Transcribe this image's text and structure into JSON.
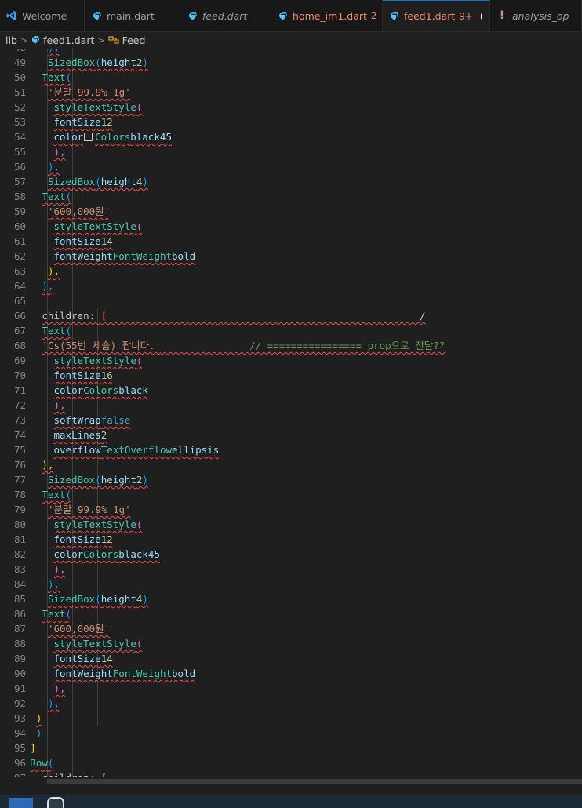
{
  "tabs": [
    {
      "label": "Welcome",
      "icon": "vscode-logo-icon",
      "style": "normal",
      "state": "plain"
    },
    {
      "label": "main.dart",
      "icon": "dart-icon",
      "style": "normal",
      "state": "plain"
    },
    {
      "label": "feed.dart",
      "icon": "dart-icon",
      "style": "italic",
      "state": "plain"
    },
    {
      "label": "home_im1.dart",
      "icon": "dart-icon",
      "style": "normal",
      "state": "error",
      "badge": "2",
      "dot": true
    },
    {
      "label": "feed1.dart",
      "icon": "dart-icon",
      "style": "normal",
      "state": "active",
      "badge": "9+",
      "dot": true
    },
    {
      "label": "analysis_op",
      "icon": "exclamation-icon",
      "style": "italic",
      "state": "plain"
    }
  ],
  "breadcrumb": {
    "folder": "lib",
    "file": "feed1.dart",
    "symbol": "Feed"
  },
  "editor": {
    "first_line": 48,
    "lines": [
      [
        [
          "b3",
          "),",
          1
        ]
      ],
      [
        [
          "k",
          "SizedBox",
          1
        ],
        [
          "b3",
          "(",
          1
        ],
        [
          "p",
          "height",
          1
        ],
        [
          "",
          "",
          1
        ],
        [
          "n",
          "2",
          1
        ],
        [
          "b3",
          ")",
          1
        ],
        [
          "",
          "",
          1
        ]
      ],
      [
        [
          "k",
          "Text",
          1
        ],
        [
          "b3",
          "(",
          1
        ]
      ],
      [
        [
          "s",
          "'분말 99.9% 1g'",
          1
        ],
        [
          "",
          "",
          1
        ]
      ],
      [
        [
          "k",
          "style",
          1
        ],
        [
          "",
          "",
          1
        ],
        [
          "k",
          "TextStyle",
          1
        ],
        [
          "b2",
          "(",
          1
        ]
      ],
      [
        [
          "p",
          "fontSize",
          1
        ],
        [
          "",
          "",
          1
        ],
        [
          "n",
          "12",
          1
        ],
        [
          "",
          "",
          1
        ]
      ],
      [
        [
          "p",
          "color",
          1
        ],
        [
          "",
          "",
          1
        ],
        [
          "sw",
          "",
          0
        ],
        [
          "k",
          "Colors",
          1
        ],
        [
          "",
          "",
          1
        ],
        [
          "p",
          "black45",
          1
        ],
        [
          "",
          "",
          1
        ]
      ],
      [
        [
          "b2",
          "),",
          1
        ]
      ],
      [
        [
          "b3",
          "),",
          1
        ]
      ],
      [
        [
          "k",
          "SizedBox",
          1
        ],
        [
          "b3",
          "(",
          1
        ],
        [
          "p",
          "height",
          1
        ],
        [
          "",
          "",
          1
        ],
        [
          "n",
          "4",
          1
        ],
        [
          "b3",
          ")",
          1
        ],
        [
          "",
          "",
          1
        ]
      ],
      [
        [
          "k",
          "Text",
          1
        ],
        [
          "b3",
          "(",
          1
        ]
      ],
      [
        [
          "s",
          "'600,000원'",
          1
        ],
        [
          "",
          "",
          1
        ]
      ],
      [
        [
          "k",
          "style",
          1
        ],
        [
          "",
          "",
          1
        ],
        [
          "k",
          "TextStyle",
          1
        ],
        [
          "b2",
          "(",
          1
        ]
      ],
      [
        [
          "p",
          "fontSize",
          1
        ],
        [
          "",
          "",
          1
        ],
        [
          "n",
          "14",
          1
        ],
        [
          "",
          "",
          1
        ]
      ],
      [
        [
          "p",
          "fontWeight",
          1
        ],
        [
          "",
          "",
          1
        ],
        [
          "k",
          "FontWeight",
          1
        ],
        [
          "",
          "",
          1
        ],
        [
          "p",
          "bold",
          1
        ],
        [
          "",
          "",
          1
        ]
      ],
      [
        [
          "b1",
          "),",
          1
        ]
      ],
      [
        [
          "b3",
          "),",
          1
        ]
      ],
      [],
      [
        [
          "",
          "children: ",
          1
        ],
        [
          "bred",
          "[",
          1
        ],
        [
          "",
          "                                                     /",
          1
        ]
      ],
      [
        [
          "k",
          "Text",
          1
        ],
        [
          "b3",
          "(",
          1
        ]
      ],
      [
        [
          "s",
          "'Cs(55번 세슘) 팝니다.'",
          1
        ],
        [
          "",
          "",
          1
        ],
        [
          "c",
          "               // ================ prop으로 전달??",
          1
        ]
      ],
      [
        [
          "k",
          "style",
          1
        ],
        [
          "",
          "",
          1
        ],
        [
          "k",
          "TextStyle",
          1
        ],
        [
          "b2",
          "(",
          1
        ]
      ],
      [
        [
          "p",
          "fontSize",
          1
        ],
        [
          "",
          "",
          1
        ],
        [
          "n",
          "16",
          1
        ],
        [
          "",
          "",
          1
        ]
      ],
      [
        [
          "p",
          "color",
          1
        ],
        [
          "",
          "",
          1
        ],
        [
          "k",
          "Colors",
          1
        ],
        [
          "",
          "",
          1
        ],
        [
          "p",
          "black",
          1
        ],
        [
          "",
          "",
          1
        ]
      ],
      [
        [
          "b2",
          "),",
          1
        ]
      ],
      [
        [
          "p",
          "softWrap",
          1
        ],
        [
          "",
          "",
          1
        ],
        [
          "bo",
          "false",
          1
        ],
        [
          "",
          "",
          1
        ]
      ],
      [
        [
          "p",
          "maxLines",
          1
        ],
        [
          "",
          "",
          1
        ],
        [
          "n",
          "2",
          1
        ],
        [
          "",
          "",
          1
        ]
      ],
      [
        [
          "p",
          "overflow",
          1
        ],
        [
          "",
          "",
          1
        ],
        [
          "k",
          "TextOverflow",
          1
        ],
        [
          "",
          "",
          1
        ],
        [
          "p",
          "ellipsis",
          1
        ],
        [
          "",
          "",
          1
        ]
      ],
      [
        [
          "b1",
          "),",
          1
        ]
      ],
      [
        [
          "k",
          "SizedBox",
          1
        ],
        [
          "b3",
          "(",
          1
        ],
        [
          "p",
          "height",
          1
        ],
        [
          "",
          "",
          1
        ],
        [
          "n",
          "2",
          1
        ],
        [
          "b3",
          ")",
          1
        ],
        [
          "",
          "",
          1
        ]
      ],
      [
        [
          "k",
          "Text",
          1
        ],
        [
          "b3",
          "(",
          1
        ]
      ],
      [
        [
          "s",
          "'분말 99.9% 1g'",
          1
        ],
        [
          "",
          "",
          1
        ]
      ],
      [
        [
          "k",
          "style",
          1
        ],
        [
          "",
          "",
          1
        ],
        [
          "k",
          "TextStyle",
          1
        ],
        [
          "b2",
          "(",
          1
        ]
      ],
      [
        [
          "p",
          "fontSize",
          1
        ],
        [
          "",
          "",
          1
        ],
        [
          "n",
          "12",
          1
        ],
        [
          "",
          "",
          1
        ]
      ],
      [
        [
          "p",
          "color",
          1
        ],
        [
          "",
          "",
          1
        ],
        [
          "k",
          "Colors",
          1
        ],
        [
          "",
          "",
          1
        ],
        [
          "p",
          "black45",
          1
        ],
        [
          "",
          "",
          1
        ]
      ],
      [
        [
          "b2",
          "),",
          1
        ]
      ],
      [
        [
          "b3",
          "),",
          1
        ]
      ],
      [
        [
          "k",
          "SizedBox",
          1
        ],
        [
          "b3",
          "(",
          1
        ],
        [
          "p",
          "height",
          1
        ],
        [
          "",
          "",
          1
        ],
        [
          "n",
          "4",
          1
        ],
        [
          "b3",
          ")",
          1
        ],
        [
          "",
          "",
          1
        ]
      ],
      [
        [
          "k",
          "Text",
          1
        ],
        [
          "b3",
          "(",
          1
        ]
      ],
      [
        [
          "s",
          "'600,000원'",
          1
        ],
        [
          "",
          "",
          1
        ]
      ],
      [
        [
          "k",
          "style",
          1
        ],
        [
          "",
          "",
          1
        ],
        [
          "k",
          "TextStyle",
          1
        ],
        [
          "b2",
          "(",
          1
        ]
      ],
      [
        [
          "p",
          "fontSize",
          1
        ],
        [
          "",
          "",
          1
        ],
        [
          "n",
          "14",
          1
        ],
        [
          "",
          "",
          1
        ]
      ],
      [
        [
          "p",
          "fontWeight",
          1
        ],
        [
          "",
          "",
          1
        ],
        [
          "k",
          "FontWeight",
          1
        ],
        [
          "",
          "",
          1
        ],
        [
          "p",
          "bold",
          1
        ],
        [
          "",
          "",
          1
        ]
      ],
      [
        [
          "b2",
          "),",
          1
        ]
      ],
      [
        [
          "b3",
          "),",
          1
        ]
      ],
      [
        [
          "b1",
          ")",
          1
        ]
      ],
      [
        [
          "b3",
          ")",
          0
        ]
      ],
      [
        [
          "b1",
          "]",
          0
        ]
      ],
      [
        [
          "k",
          "Row",
          1
        ],
        [
          "b3",
          "(",
          1
        ]
      ],
      [
        [
          "",
          "children: [",
          0
        ]
      ]
    ]
  }
}
